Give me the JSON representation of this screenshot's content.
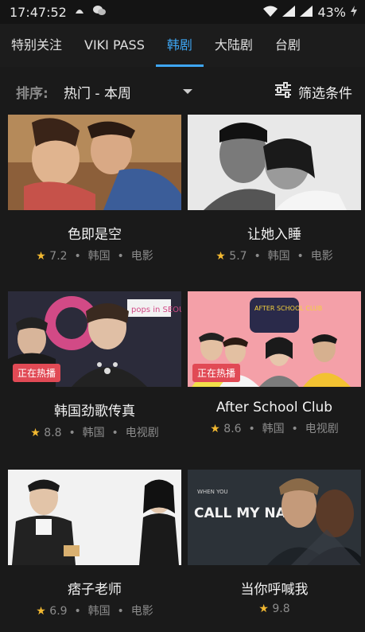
{
  "status_bar": {
    "time": "17:47:52",
    "battery": "43%"
  },
  "tabs": [
    {
      "label": "特别关注",
      "active": false
    },
    {
      "label": "VIKI PASS",
      "active": false
    },
    {
      "label": "韩剧",
      "active": true
    },
    {
      "label": "大陆剧",
      "active": false
    },
    {
      "label": "台剧",
      "active": false
    }
  ],
  "sort": {
    "label": "排序:",
    "value": "热门 - 本周"
  },
  "filter": {
    "label": "筛选条件"
  },
  "separator": "•",
  "star": "★",
  "items": [
    {
      "title": "色即是空",
      "rating": "7.2",
      "country": "韩国",
      "type": "电影",
      "badge": ""
    },
    {
      "title": "让她入睡",
      "rating": "5.7",
      "country": "韩国",
      "type": "电影",
      "badge": ""
    },
    {
      "title": "韩国劲歌传真",
      "rating": "8.8",
      "country": "韩国",
      "type": "电视剧",
      "badge": "正在热播"
    },
    {
      "title": "After School Club",
      "rating": "8.6",
      "country": "韩国",
      "type": "电视剧",
      "badge": "正在热播"
    },
    {
      "title": "痞子老师",
      "rating": "6.9",
      "country": "韩国",
      "type": "电影",
      "badge": ""
    },
    {
      "title": "当你呼喊我",
      "rating": "9.8",
      "country": "",
      "type": "",
      "badge": ""
    }
  ],
  "thumb_text": {
    "pops_logo": "pops in SEOUL",
    "after_school_logo": "AFTER SCHOOL CLUB",
    "cmbyn_small": "WHEN YOU",
    "cmbyn_title": "CALL MY NAME"
  },
  "colors": {
    "accent": "#3ea6f3",
    "badge": "#e14a55",
    "star": "#f3b931"
  }
}
